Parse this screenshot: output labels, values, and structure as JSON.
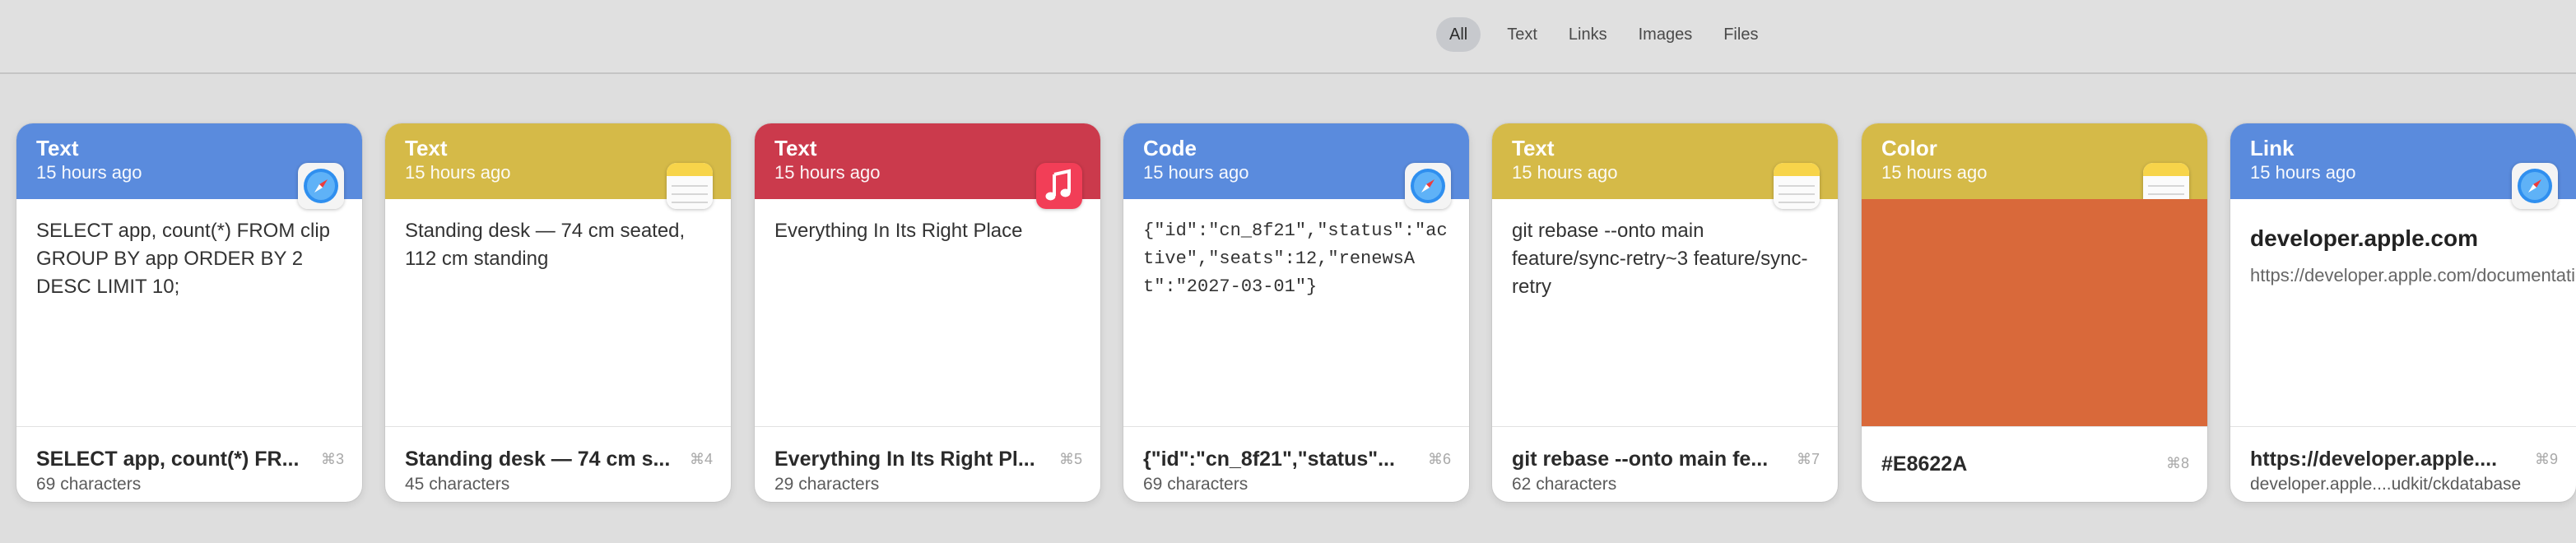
{
  "filter_tabs": [
    {
      "label": "All",
      "active": true
    },
    {
      "label": "Text",
      "active": false
    },
    {
      "label": "Links",
      "active": false
    },
    {
      "label": "Images",
      "active": false
    },
    {
      "label": "Files",
      "active": false
    }
  ],
  "colors": {
    "blue": "#5A8BDD",
    "yellow": "#D5BA48",
    "red": "#CB3A4C",
    "swatch": "#E8622A"
  },
  "cards": [
    {
      "type": "Text",
      "time": "15 hours ago",
      "header_color": "blue",
      "app_icon": "safari-icon",
      "body": "SELECT app, count(*) FROM clip GROUP BY app ORDER BY 2 DESC LIMIT 10;",
      "footer_title": "SELECT app, count(*) FR...",
      "footer_sub": "69 characters",
      "shortcut": "⌘3"
    },
    {
      "type": "Text",
      "time": "15 hours ago",
      "header_color": "yellow",
      "app_icon": "notes-icon",
      "body": "Standing desk — 74 cm seated, 112 cm standing",
      "footer_title": "Standing desk — 74 cm s...",
      "footer_sub": "45 characters",
      "shortcut": "⌘4"
    },
    {
      "type": "Text",
      "time": "15 hours ago",
      "header_color": "red",
      "app_icon": "music-icon",
      "body": "Everything In Its Right Place",
      "footer_title": "Everything In Its Right Pl...",
      "footer_sub": "29 characters",
      "shortcut": "⌘5"
    },
    {
      "type": "Code",
      "time": "15 hours ago",
      "header_color": "blue",
      "app_icon": "safari-icon",
      "body": "{\"id\":\"cn_8f21\",\"status\":\"active\",\"seats\":12,\"renewsAt\":\"2027-03-01\"}",
      "footer_title": "{\"id\":\"cn_8f21\",\"status\"...",
      "footer_sub": "69 characters",
      "shortcut": "⌘6"
    },
    {
      "type": "Text",
      "time": "15 hours ago",
      "header_color": "yellow",
      "app_icon": "notes-icon",
      "body": "git rebase --onto main feature/sync-retry~3 feature/sync-retry",
      "footer_title": "git rebase --onto main fe...",
      "footer_sub": "62 characters",
      "shortcut": "⌘7"
    },
    {
      "type": "Color",
      "time": "15 hours ago",
      "header_color": "yellow",
      "app_icon": "notes-icon",
      "swatch": "#E8622A",
      "footer_title": "#E8622A",
      "shortcut": "⌘8"
    },
    {
      "type": "Link",
      "time": "15 hours ago",
      "header_color": "blue",
      "app_icon": "safari-icon",
      "link_host": "developer.apple.com",
      "link_url": "https://developer.apple.com/documentation/cloudkit/ckdatabase",
      "footer_title": "https://developer.apple....",
      "footer_sub": "developer.apple....udkit/ckdatabase",
      "shortcut": "⌘9"
    }
  ]
}
